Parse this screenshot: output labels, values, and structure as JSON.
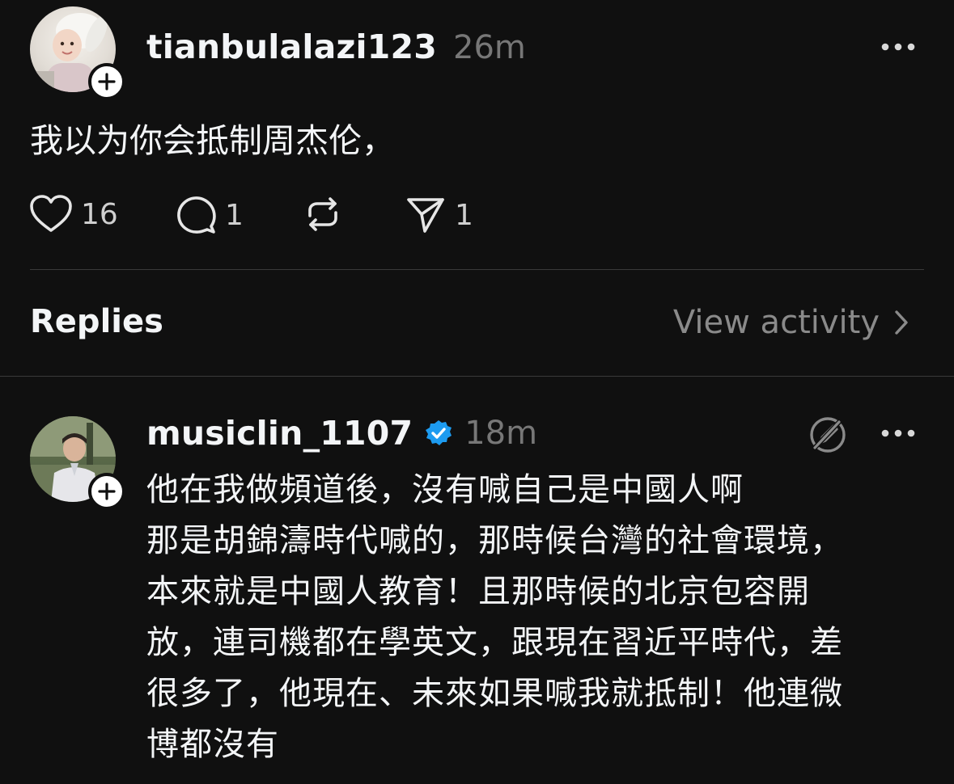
{
  "post": {
    "username": "tianbulalazi123",
    "time": "26m",
    "text": "我以为你会抵制周杰伦，",
    "likes": "16",
    "comments": "1",
    "shares": "1"
  },
  "section": {
    "replies_label": "Replies",
    "view_activity_label": "View activity"
  },
  "reply": {
    "username": "musiclin_1107",
    "time": "18m",
    "verified": true,
    "lines": [
      "他在我做頻道後，沒有喊自己是中國人啊",
      "那是胡錦濤時代喊的，那時候台灣的社會環境，",
      "本來就是中國人教育！且那時候的北京包容開",
      "放，連司機都在學英文，跟現在習近平時代，差",
      "很多了，他現在、未來如果喊我就抵制！他連微",
      "博都沒有"
    ]
  },
  "icons": {
    "like": "heart-icon",
    "comment": "comment-icon",
    "repost": "repost-icon",
    "share": "send-icon",
    "more": "more-icon",
    "follow": "plus-icon",
    "verified": "verified-badge-icon",
    "edit_off": "edit-off-icon",
    "chevron": "chevron-right-icon"
  },
  "colors": {
    "background": "#101010",
    "text": "#f3f5f7",
    "muted": "#777777",
    "verified": "#1d9bf0"
  }
}
